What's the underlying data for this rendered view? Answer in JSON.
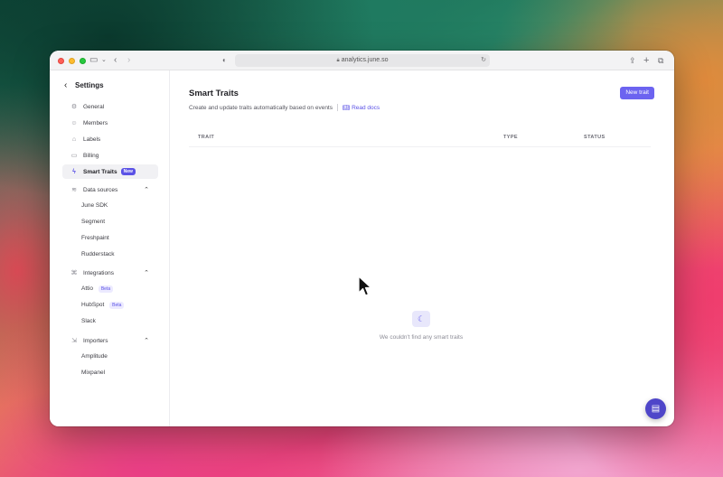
{
  "browser": {
    "url": "analytics.june.so"
  },
  "sidebar": {
    "title": "Settings",
    "items": {
      "general": "General",
      "members": "Members",
      "labels": "Labels",
      "billing": "Billing",
      "smart_traits": "Smart Traits",
      "smart_traits_badge": "New",
      "data_sources": "Data sources",
      "importers": "Importers",
      "integrations": "Integrations"
    },
    "data_sources_sub": [
      "June SDK",
      "Segment",
      "Freshpaint",
      "Rudderstack"
    ],
    "integrations_sub": {
      "attio": "Attio",
      "attio_badge": "Beta",
      "hubspot": "HubSpot",
      "hubspot_badge": "Beta",
      "slack": "Slack"
    },
    "importers_sub": [
      "Amplitude",
      "Mixpanel"
    ]
  },
  "main": {
    "title": "Smart Traits",
    "subtitle": "Create and update traits automatically based on events",
    "read_docs": "Read docs",
    "new_button": "New trait",
    "columns": [
      "TRAIT",
      "TYPE",
      "STATUS"
    ],
    "empty_text": "We couldn't find any smart traits"
  },
  "colors": {
    "accent": "#6c63f0",
    "badge_new": "#5b52e6",
    "chat_button": "#4f46c9"
  }
}
